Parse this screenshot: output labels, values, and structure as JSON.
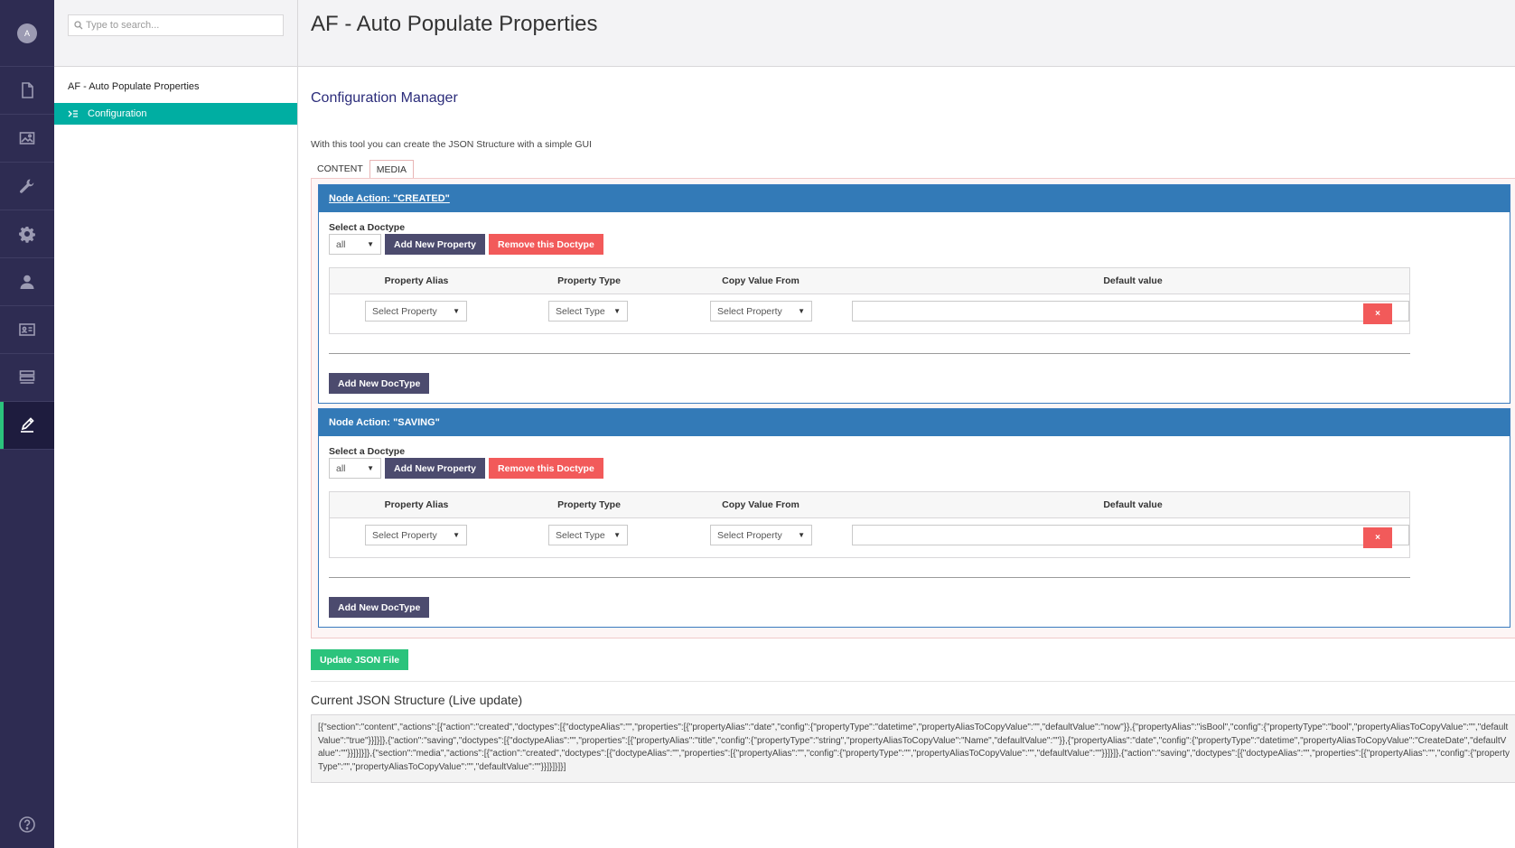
{
  "rail": {
    "avatar_initial": "A",
    "items": [
      "content-icon",
      "media-icon",
      "wrench-icon",
      "settings-gear-icon",
      "user-icon",
      "id-card-icon",
      "forms-icon",
      "edit-icon"
    ],
    "active": "edit-icon",
    "help_icon": "help-icon"
  },
  "tree": {
    "search_placeholder": "Type to search...",
    "root_label": "AF - Auto Populate Properties",
    "node_label": "Configuration"
  },
  "header": {
    "title": "AF - Auto Populate Properties"
  },
  "main": {
    "section_title": "Configuration Manager",
    "description": "With this tool you can create the JSON Structure with a simple GUI",
    "tabs": [
      {
        "label": "CONTENT",
        "active": false
      },
      {
        "label": "MEDIA",
        "active": true
      }
    ],
    "node_actions": [
      {
        "header": "Node Action: \"CREATED\"",
        "select_doctype_label": "Select a Doctype",
        "doctype_value": "all",
        "add_property_label": "Add New Property",
        "remove_doctype_label": "Remove this Doctype",
        "columns": [
          "Property Alias",
          "Property Type",
          "Copy Value From",
          "Default value"
        ],
        "row": {
          "alias_select": "Select Property",
          "type_select": "Select Type",
          "copy_select": "Select Property",
          "default_value": "",
          "delete_label": "×"
        },
        "add_doctype_label": "Add New DocType"
      },
      {
        "header": "Node Action: \"SAVING\"",
        "select_doctype_label": "Select a Doctype",
        "doctype_value": "all",
        "add_property_label": "Add New Property",
        "remove_doctype_label": "Remove this Doctype",
        "columns": [
          "Property Alias",
          "Property Type",
          "Copy Value From",
          "Default value"
        ],
        "row": {
          "alias_select": "Select Property",
          "type_select": "Select Type",
          "copy_select": "Select Property",
          "default_value": "",
          "delete_label": "×"
        },
        "add_doctype_label": "Add New DocType"
      }
    ],
    "update_button_label": "Update JSON File",
    "json_title": "Current JSON Structure (Live update)",
    "json_content": "[{\"section\":\"content\",\"actions\":[{\"action\":\"created\",\"doctypes\":[{\"doctypeAlias\":\"\",\"properties\":[{\"propertyAlias\":\"date\",\"config\":{\"propertyType\":\"datetime\",\"propertyAliasToCopyValue\":\"\",\"defaultValue\":\"now\"}},{\"propertyAlias\":\"isBool\",\"config\":{\"propertyType\":\"bool\",\"propertyAliasToCopyValue\":\"\",\"defaultValue\":\"true\"}}]}]},{\"action\":\"saving\",\"doctypes\":[{\"doctypeAlias\":\"\",\"properties\":[{\"propertyAlias\":\"title\",\"config\":{\"propertyType\":\"string\",\"propertyAliasToCopyValue\":\"Name\",\"defaultValue\":\"\"}},{\"propertyAlias\":\"date\",\"config\":{\"propertyType\":\"datetime\",\"propertyAliasToCopyValue\":\"CreateDate\",\"defaultValue\":\"\"}}]}]}]},{\"section\":\"media\",\"actions\":[{\"action\":\"created\",\"doctypes\":[{\"doctypeAlias\":\"\",\"properties\":[{\"propertyAlias\":\"\",\"config\":{\"propertyType\":\"\",\"propertyAliasToCopyValue\":\"\",\"defaultValue\":\"\"}}]}]},{\"action\":\"saving\",\"doctypes\":[{\"doctypeAlias\":\"\",\"properties\":[{\"propertyAlias\":\"\",\"config\":{\"propertyType\":\"\",\"propertyAliasToCopyValue\":\"\",\"defaultValue\":\"\"}}]}]}]}]"
  },
  "colors": {
    "rail_bg": "#2e2c52",
    "active_accent": "#2bc37c",
    "tree_selected": "#00aea2",
    "node_header": "#337ab7",
    "button_purple": "#4c4b6e",
    "button_red": "#f25a5a",
    "button_green": "#2bc37c"
  }
}
